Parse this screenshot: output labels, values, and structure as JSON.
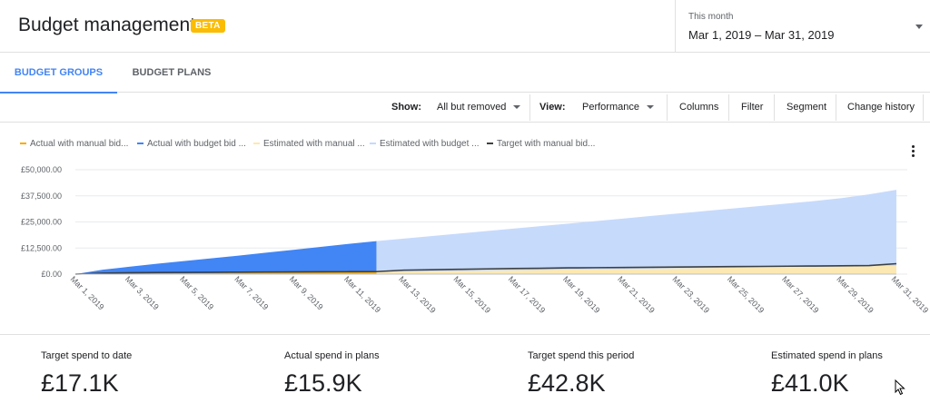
{
  "header": {
    "title": "Budget management",
    "badge": "BETA",
    "date_caption": "This month",
    "date_range": "Mar 1, 2019 – Mar 31, 2019"
  },
  "tabs": [
    {
      "label": "BUDGET GROUPS",
      "active": true
    },
    {
      "label": "BUDGET PLANS",
      "active": false
    }
  ],
  "toolbar": {
    "show_label": "Show:",
    "show_value": "All but removed",
    "view_label": "View:",
    "view_value": "Performance",
    "columns": "Columns",
    "filter": "Filter",
    "segment": "Segment",
    "change_history": "Change history"
  },
  "legend": [
    {
      "label": "Actual with manual bid...",
      "color": "#f9ab00"
    },
    {
      "label": "Actual with budget bid ...",
      "color": "#4285f4"
    },
    {
      "label": "Estimated with manual ...",
      "color": "#fce8b2"
    },
    {
      "label": "Estimated with budget ...",
      "color": "#c6dafc"
    },
    {
      "label": "Target with manual bid...",
      "color": "#3c4043"
    }
  ],
  "chart_data": {
    "type": "area",
    "x": [
      "Mar 1, 2019",
      "Mar 2, 2019",
      "Mar 3, 2019",
      "Mar 4, 2019",
      "Mar 5, 2019",
      "Mar 6, 2019",
      "Mar 7, 2019",
      "Mar 8, 2019",
      "Mar 9, 2019",
      "Mar 10, 2019",
      "Mar 11, 2019",
      "Mar 12, 2019",
      "Mar 13, 2019",
      "Mar 14, 2019",
      "Mar 15, 2019",
      "Mar 16, 2019",
      "Mar 17, 2019",
      "Mar 18, 2019",
      "Mar 19, 2019",
      "Mar 20, 2019",
      "Mar 21, 2019",
      "Mar 22, 2019",
      "Mar 23, 2019",
      "Mar 24, 2019",
      "Mar 25, 2019",
      "Mar 26, 2019",
      "Mar 27, 2019",
      "Mar 28, 2019",
      "Mar 29, 2019",
      "Mar 30, 2019",
      "Mar 31, 2019"
    ],
    "tick_labels": [
      "Mar 1, 2019",
      "Mar 3, 2019",
      "Mar 5, 2019",
      "Mar 7, 2019",
      "Mar 9, 2019",
      "Mar 11, 2019",
      "Mar 13, 2019",
      "Mar 15, 2019",
      "Mar 17, 2019",
      "Mar 19, 2019",
      "Mar 21, 2019",
      "Mar 23, 2019",
      "Mar 25, 2019",
      "Mar 27, 2019",
      "Mar 29, 2019",
      "Mar 31, 2019"
    ],
    "y_tick_labels": [
      "£50,000.00",
      "£37,500.00",
      "£25,000.00",
      "£12,500.00",
      "£0.00"
    ],
    "ylim": [
      0,
      50000
    ],
    "series": [
      {
        "name": "Actual with manual bid...",
        "color": "#f9ab00",
        "kind": "area",
        "values": [
          0,
          100,
          200,
          300,
          400,
          500,
          600,
          700,
          800,
          900,
          1000,
          1100
        ]
      },
      {
        "name": "Actual with budget bid ...",
        "color": "#4285f4",
        "kind": "area",
        "values": [
          0,
          2100,
          3600,
          5000,
          6300,
          7600,
          8900,
          10300,
          11700,
          13100,
          14500,
          15800
        ]
      },
      {
        "name": "Estimated with manual ...",
        "color": "#fce8b2",
        "kind": "area",
        "values": [
          null,
          null,
          null,
          null,
          null,
          null,
          null,
          null,
          null,
          null,
          null,
          1100,
          1250,
          1400,
          1550,
          1700,
          1850,
          2000,
          2150,
          2300,
          2450,
          2600,
          2750,
          2900,
          3050,
          3200,
          3350,
          3500,
          3650,
          3800,
          4000
        ]
      },
      {
        "name": "Estimated with budget ...",
        "color": "#c6dafc",
        "kind": "area",
        "values": [
          null,
          null,
          null,
          null,
          null,
          null,
          null,
          null,
          null,
          null,
          null,
          15800,
          17000,
          18200,
          19400,
          20600,
          21800,
          23000,
          24200,
          25400,
          26600,
          27800,
          29000,
          30200,
          31400,
          32600,
          33800,
          35000,
          36400,
          38200,
          40400
        ]
      },
      {
        "name": "Target with manual bid...",
        "color": "#3c4043",
        "kind": "line",
        "values": [
          0,
          450,
          700,
          800,
          850,
          900,
          950,
          1000,
          1050,
          1100,
          1150,
          1200,
          1900,
          2100,
          2300,
          2500,
          2700,
          2800,
          3000,
          3100,
          3200,
          3300,
          3400,
          3500,
          3600,
          3700,
          3800,
          3900,
          4000,
          4100,
          5000
        ]
      }
    ]
  },
  "summary": [
    {
      "label": "Target spend to date",
      "value": "£17.1K"
    },
    {
      "label": "Actual spend in plans",
      "value": "£15.9K"
    },
    {
      "label": "Target spend this period",
      "value": "£42.8K"
    },
    {
      "label": "Estimated spend in plans",
      "value": "£41.0K"
    }
  ]
}
